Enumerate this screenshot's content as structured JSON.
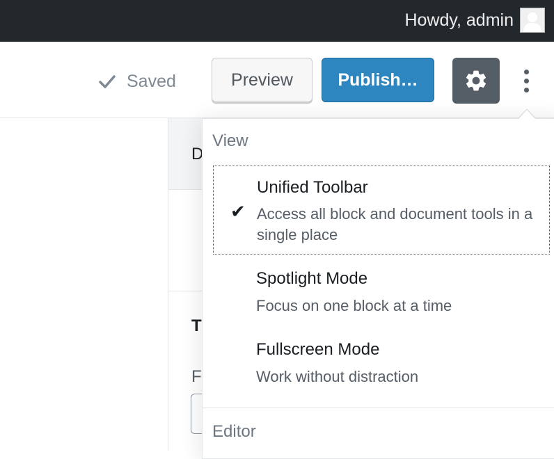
{
  "admin_bar": {
    "greeting": "Howdy, admin"
  },
  "header": {
    "saved_label": "Saved",
    "preview_label": "Preview",
    "publish_label": "Publish…",
    "settings_icon": "gear-icon",
    "more_icon": "vertical-ellipsis-icon"
  },
  "sidebar": {
    "tab_fragment": "D",
    "panel_title_fragment": "T",
    "field_label_fragment": "F"
  },
  "menu": {
    "groups": [
      {
        "label": "View",
        "items": [
          {
            "title": "Unified Toolbar",
            "description": "Access all block and document tools in a single place",
            "checked": true
          },
          {
            "title": "Spotlight Mode",
            "description": "Focus on one block at a time",
            "checked": false
          },
          {
            "title": "Fullscreen Mode",
            "description": "Work without distraction",
            "checked": false
          }
        ]
      },
      {
        "label": "Editor",
        "items": []
      }
    ]
  },
  "colors": {
    "admin_bar": "#23282d",
    "publish": "#2e86c1",
    "settings_active": "#555d66"
  }
}
